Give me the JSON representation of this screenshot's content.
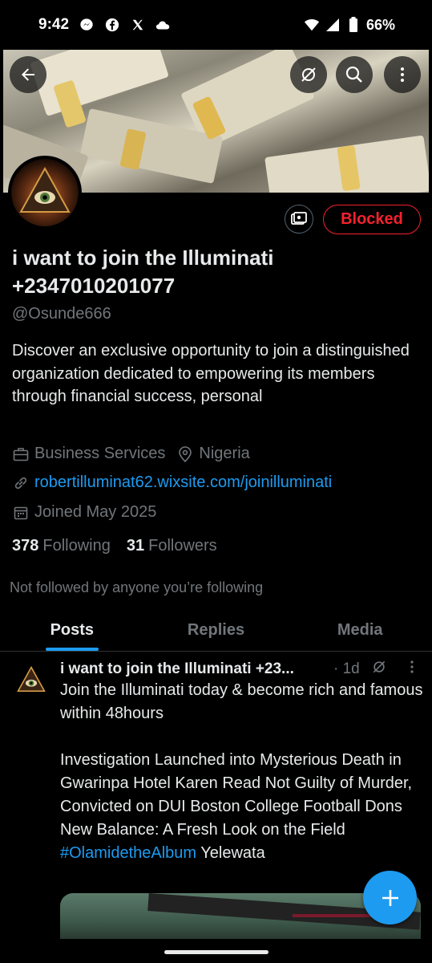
{
  "status_bar": {
    "time": "9:42",
    "battery": "66%",
    "notification_icons": [
      "messenger-icon",
      "facebook-icon",
      "x-icon",
      "cloud-icon"
    ],
    "system_icons": [
      "wifi-icon",
      "signal-icon",
      "battery-icon"
    ]
  },
  "header": {
    "back_icon": "arrow-left-icon",
    "grok_icon": "grok-icon",
    "search_icon": "search-icon",
    "more_icon": "more-vertical-icon"
  },
  "profile": {
    "name": "i want to join the Illuminati +2347010201077",
    "handle": "@Osunde666",
    "blocked_label": "Blocked",
    "bio": "Discover an exclusive opportunity to join a distinguished organization dedicated to empowering its members through financial success, personal",
    "category": "Business Services",
    "location": "Nigeria",
    "website": "robertilluminat62.wixsite.com/joinilluminati",
    "joined": "Joined May 2025",
    "following_count": "378",
    "following_label": "Following",
    "followers_count": "31",
    "followers_label": "Followers",
    "not_followed": "Not followed by anyone you’re following"
  },
  "tabs": [
    {
      "label": "Posts",
      "active": true
    },
    {
      "label": "Replies",
      "active": false
    },
    {
      "label": "Media",
      "active": false
    }
  ],
  "post": {
    "author": "i want to join the Illuminati +23...",
    "time": "· 1d",
    "text_line1": "Join the Illuminati today & become rich and famous within 48hours",
    "text_line2": "Investigation Launched into Mysterious Death in Gwarinpa Hotel Karen Read Not Guilty of Murder, Convicted on DUI Boston College Football Dons New Balance: A Fresh Look on the Field ",
    "hashtag": "#OlamidetheAlbum",
    "text_tail": " Yelewata"
  },
  "colors": {
    "accent": "#1d9bf0",
    "blocked": "#f4212e",
    "muted": "#71767b",
    "text": "#e7e9ea"
  }
}
